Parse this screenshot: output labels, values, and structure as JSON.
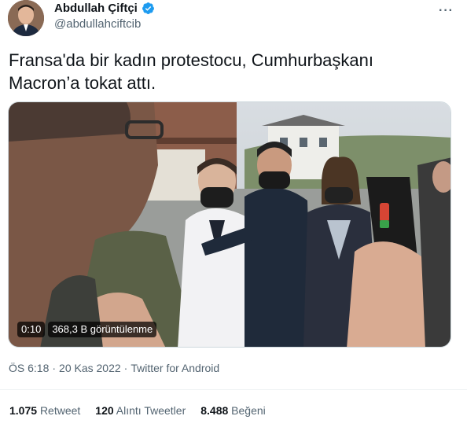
{
  "author": {
    "name": "Abdullah Çiftçi",
    "handle": "@abdullahciftcib"
  },
  "menu_glyph": "···",
  "tweet_text": "Fransa'da bir kadın protestocu, Cumhurbaşkanı Macron’a tokat attı.",
  "video": {
    "duration": "0:10",
    "views": "368,3 B görüntülenme"
  },
  "meta": {
    "time": "ÖS 6:18",
    "sep1": "·",
    "date": "20 Kas 2022",
    "sep2": "·",
    "source": "Twitter for Android"
  },
  "stats": {
    "retweets_count": "1.075",
    "retweets_label": "Retweet",
    "quotes_count": "120",
    "quotes_label": "Alıntı Tweetler",
    "likes_count": "8.488",
    "likes_label": "Beğeni"
  },
  "colors": {
    "verified": "#1d9bf0",
    "muted": "#536471",
    "text": "#0f1419"
  }
}
